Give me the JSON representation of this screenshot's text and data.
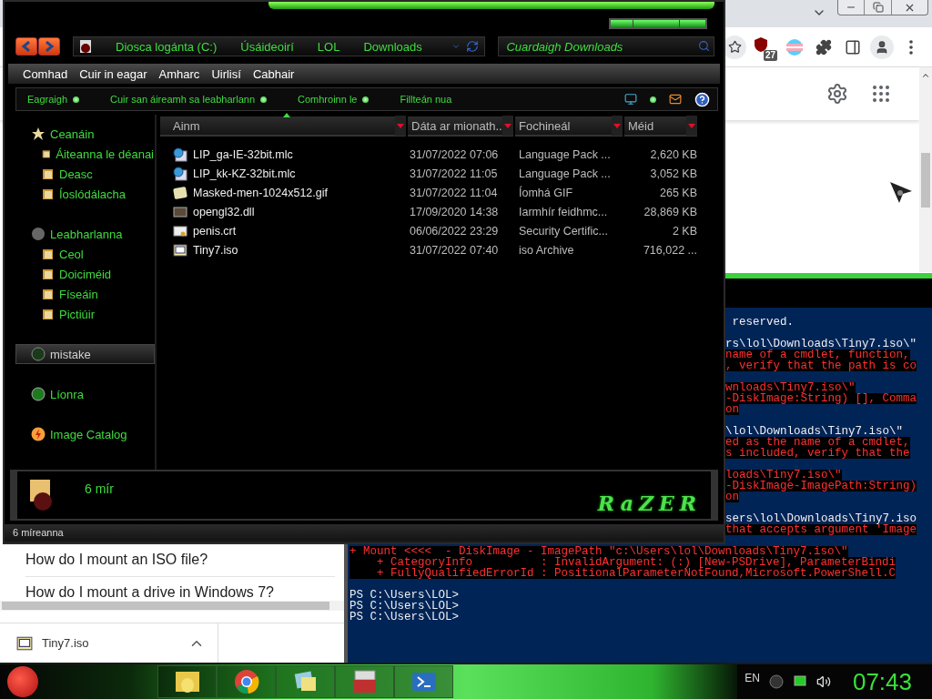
{
  "browser": {
    "extension_badge": "27",
    "results": [
      "How do I mount an ISO file?",
      "How do I mount a drive in Windows 7?"
    ],
    "download": {
      "filename": "Tiny7.iso"
    }
  },
  "console": {
    "lines_beside_explorer": [
      {
        "kind": "output",
        "text": " reserved."
      },
      {
        "kind": "blank"
      },
      {
        "kind": "output",
        "text": "rs\\lol\\Downloads\\Tiny7.iso\\\""
      },
      {
        "kind": "error",
        "text": "name of a cmdlet, function,"
      },
      {
        "kind": "error",
        "text": ", verify that the path is co"
      },
      {
        "kind": "blank"
      },
      {
        "kind": "error",
        "text": "wnloads\\Tiny7.iso\\\""
      },
      {
        "kind": "error",
        "text": "-DiskImage:String) [], Comma"
      },
      {
        "kind": "error",
        "text": "on"
      },
      {
        "kind": "blank"
      },
      {
        "kind": "output",
        "text": "\\lol\\Downloads\\Tiny7.iso\\\""
      },
      {
        "kind": "error",
        "text": "ed as the name of a cmdlet,"
      },
      {
        "kind": "error",
        "text": "s included, verify that the"
      },
      {
        "kind": "blank"
      },
      {
        "kind": "error",
        "text": "loads\\Tiny7.iso\\\""
      },
      {
        "kind": "error",
        "text": "-DiskImage-ImagePath:String)"
      },
      {
        "kind": "error",
        "text": "on"
      },
      {
        "kind": "blank"
      },
      {
        "kind": "output",
        "text": "sers\\lol\\Downloads\\Tiny7.iso"
      },
      {
        "kind": "error",
        "text": "that accepts argument 'Image"
      },
      {
        "kind": "blank"
      }
    ],
    "lines": [
      {
        "kind": "error",
        "text": "+ Mount <<<<  - DiskImage - ImagePath \"c:\\Users\\lol\\Downloads\\Tiny7.iso\\\""
      },
      {
        "kind": "error",
        "text": "    + CategoryInfo          : InvalidArgument: (:) [New-PSDrive], ParameterBindi"
      },
      {
        "kind": "error",
        "text": "    + FullyQualifiedErrorId : PositionalParameterNotFound,Microsoft.PowerShell.C"
      },
      {
        "kind": "blank"
      },
      {
        "kind": "prompt",
        "text": "PS C:\\Users\\LOL>"
      },
      {
        "kind": "prompt",
        "text": "PS C:\\Users\\LOL>"
      },
      {
        "kind": "prompt",
        "text": "PS C:\\Users\\LOL>"
      }
    ]
  },
  "explorer": {
    "address": [
      "Diosca logánta (C:)",
      "Úsáideoirí",
      "LOL",
      "Downloads"
    ],
    "search": {
      "placeholder": "Cuardaigh Downloads"
    },
    "menu": [
      "Comhad",
      "Cuir in eagar",
      "Amharc",
      "Uirlisí",
      "Cabhair"
    ],
    "commands": [
      {
        "label": "Eagraigh",
        "has_menu": true
      },
      {
        "label": "Cuir san áireamh sa leabharlann",
        "has_menu": true
      },
      {
        "label": "Comhroinn le",
        "has_menu": true
      },
      {
        "label": "Fillteán nua",
        "has_menu": false
      }
    ],
    "sidebar": [
      {
        "kind": "favorites",
        "label": "Ceanáin",
        "selected": false,
        "children": [
          {
            "label": "Áiteanna le déanai",
            "selected": false
          },
          {
            "label": "Deasc",
            "selected": false
          },
          {
            "label": "Íoslódálacha",
            "selected": false
          }
        ]
      },
      {
        "kind": "libraries",
        "label": "Leabharlanna",
        "selected": false,
        "children": [
          {
            "label": "Ceol",
            "selected": false
          },
          {
            "label": "Doiciméid",
            "selected": false
          },
          {
            "label": "Físeáin",
            "selected": false
          },
          {
            "label": "Pictiúir",
            "selected": false
          }
        ]
      },
      {
        "kind": "homegroup",
        "label": "mistake",
        "selected": true
      },
      {
        "kind": "network",
        "label": "Líonra",
        "selected": false
      },
      {
        "kind": "catalog",
        "label": "Image Catalog",
        "selected": false
      }
    ],
    "columns": [
      {
        "label": "Ainm",
        "sorted": true
      },
      {
        "label": "Dáta ar mionath..",
        "sorted": false
      },
      {
        "label": "Fochineál",
        "sorted": false
      },
      {
        "label": "Méid",
        "sorted": false
      }
    ],
    "files": [
      {
        "kind": "language-pack",
        "name": "LIP_ga-IE-32bit.mlc",
        "date": "31/07/2022 07:06",
        "type": "Language Pack ...",
        "size": "2,620 KB"
      },
      {
        "kind": "language-pack",
        "name": "LIP_kk-KZ-32bit.mlc",
        "date": "31/07/2022 11:05",
        "type": "Language Pack ...",
        "size": "3,052 KB"
      },
      {
        "kind": "image",
        "name": "Masked-men-1024x512.gif",
        "date": "31/07/2022 11:04",
        "type": "Íomhá GIF",
        "size": "265 KB"
      },
      {
        "kind": "library",
        "name": "opengl32.dll",
        "date": "17/09/2020 14:38",
        "type": "Iarmhír feidhmc...",
        "size": "28,869 KB"
      },
      {
        "kind": "certificate",
        "name": "penis.crt",
        "date": "06/06/2022 23:29",
        "type": "Security Certific...",
        "size": "2 KB"
      },
      {
        "kind": "disc",
        "name": "Tiny7.iso",
        "date": "31/07/2022 07:40",
        "type": "iso Archive",
        "size": "716,022 ..."
      }
    ],
    "details": {
      "count": "6 mír",
      "logo": "RaZER"
    },
    "status_bar": "6 míreanna"
  },
  "taskbar": {
    "language": "EN",
    "clock": "07:43"
  }
}
